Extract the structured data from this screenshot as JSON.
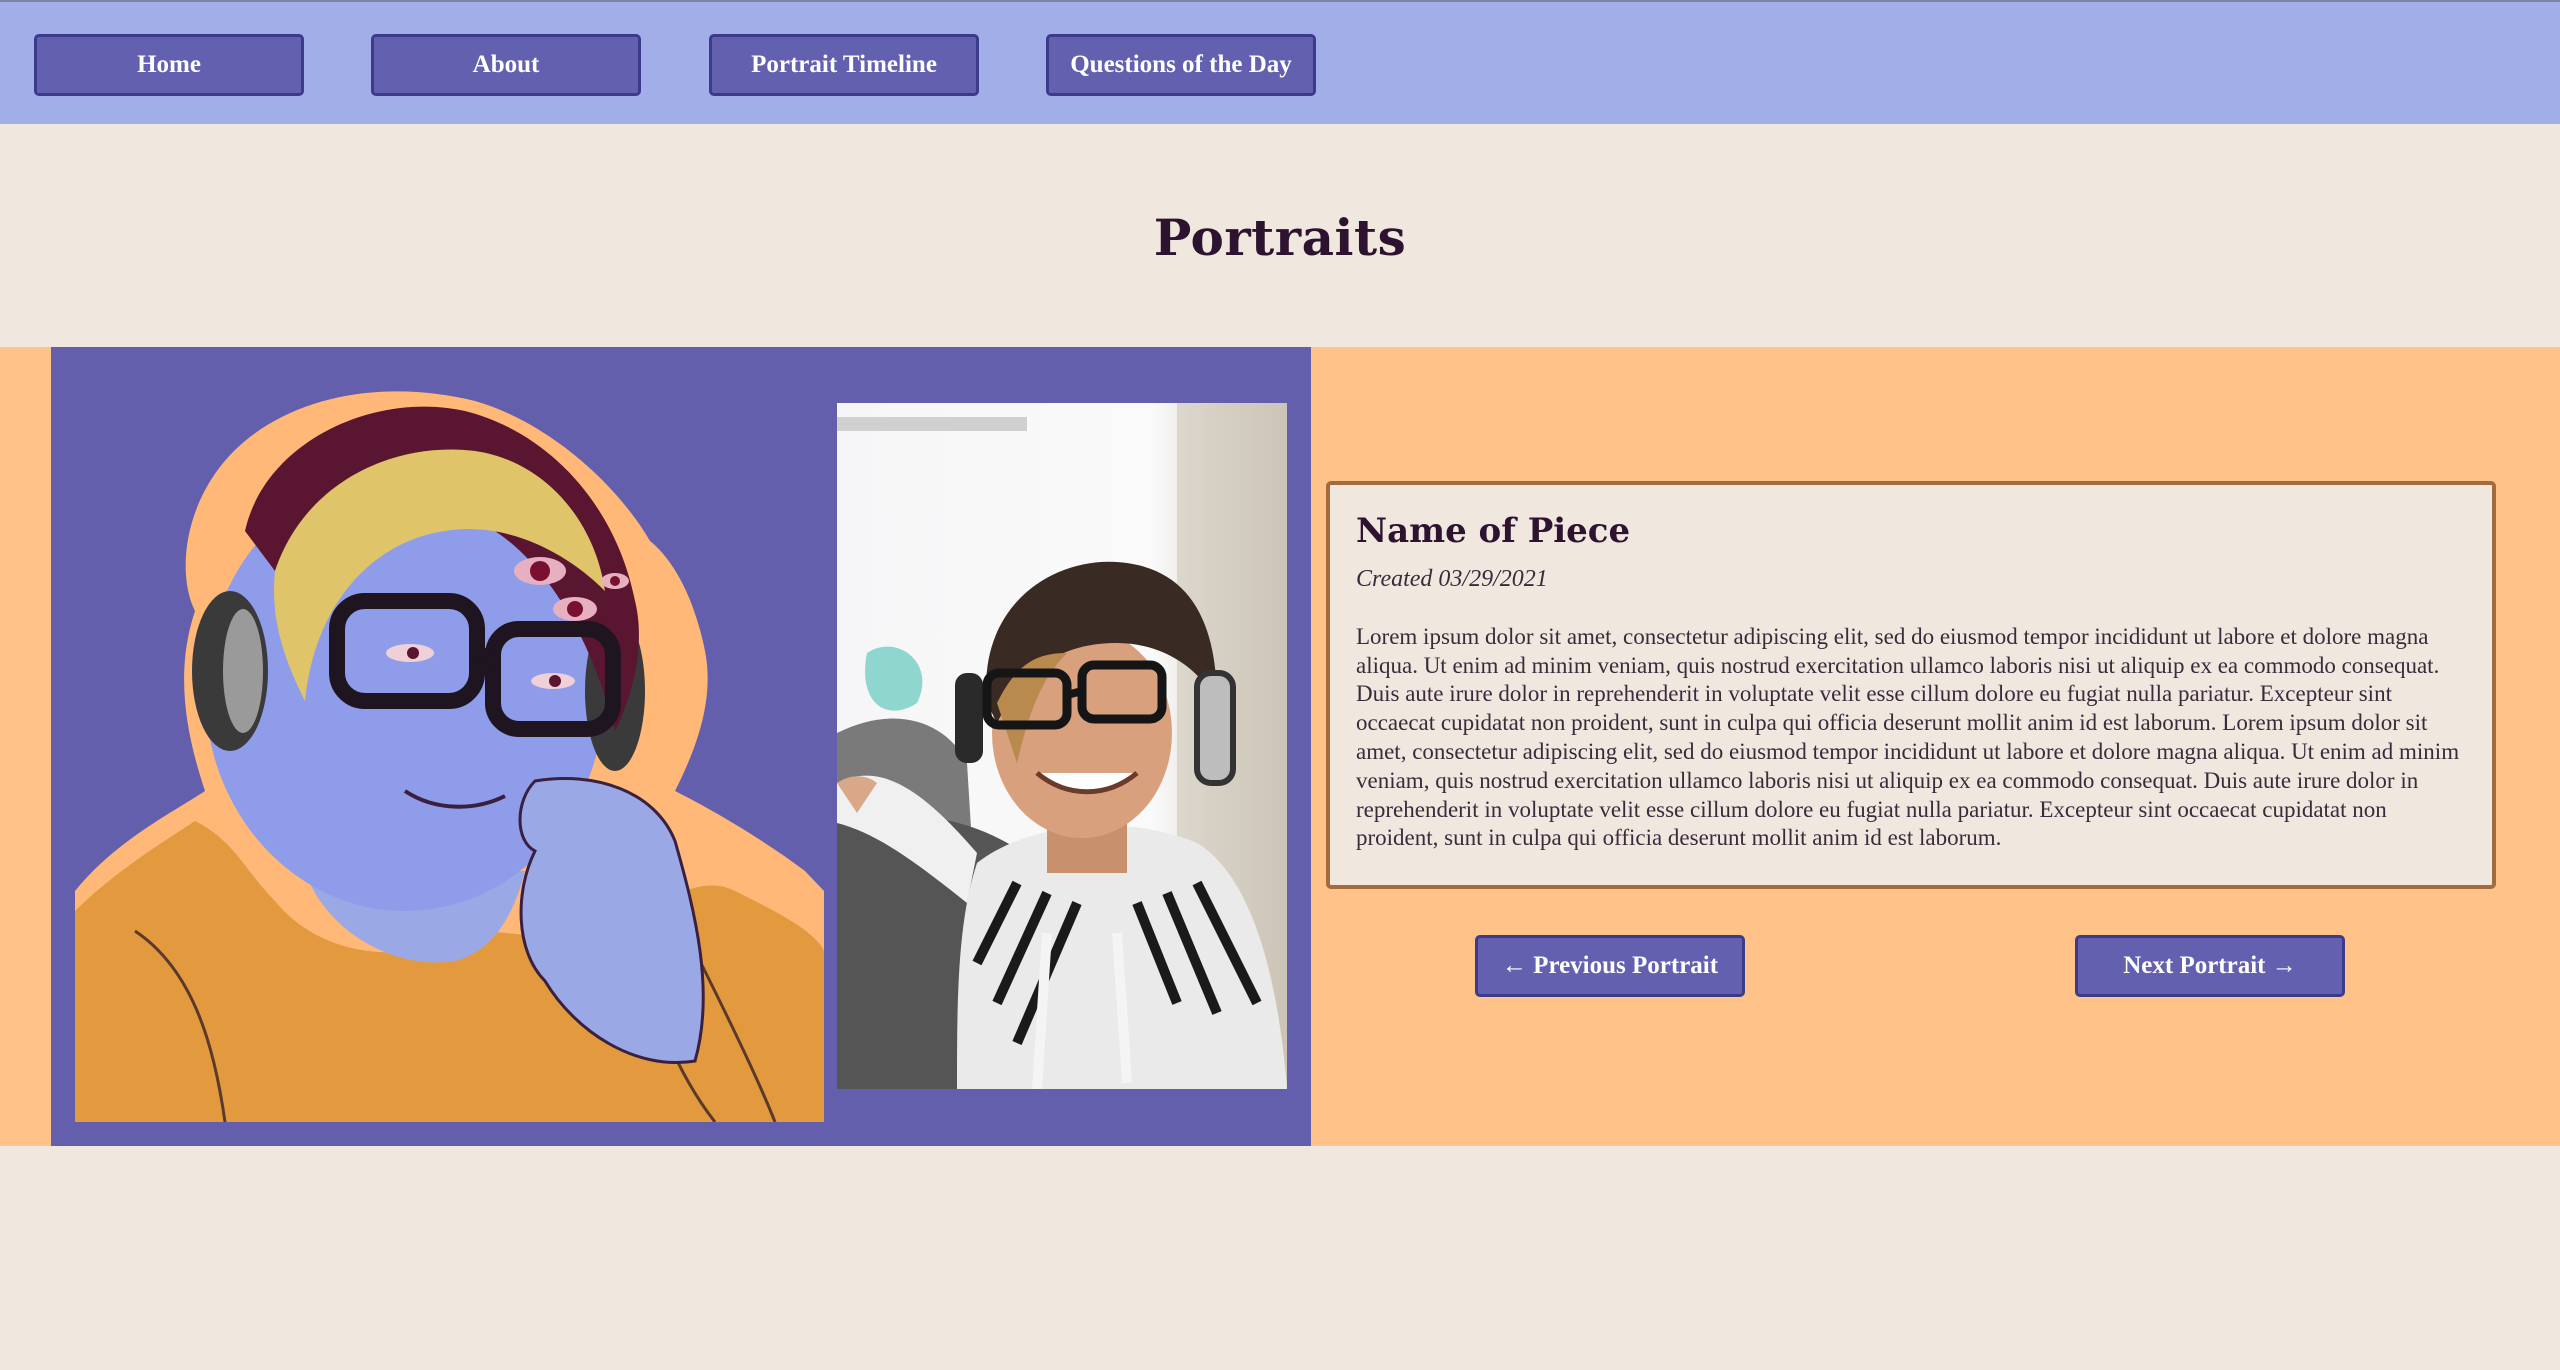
{
  "nav": {
    "items": [
      {
        "label": "Home"
      },
      {
        "label": "About"
      },
      {
        "label": "Portrait Timeline"
      },
      {
        "label": "Questions of the Day"
      }
    ]
  },
  "page": {
    "title": "Portraits"
  },
  "piece": {
    "name": "Name of Piece",
    "created": "Created 03/29/2021",
    "description": "Lorem ipsum dolor sit amet, consectetur adipiscing elit, sed do eiusmod tempor incididunt ut labore et dolore magna aliqua. Ut enim ad minim veniam, quis nostrud exercitation ullamco laboris nisi ut aliquip ex ea commodo consequat. Duis aute irure dolor in reprehenderit in voluptate velit esse cillum dolore eu fugiat nulla pariatur. Excepteur sint occaecat cupidatat non proident, sunt in culpa qui officia deserunt mollit anim id est laborum. Lorem ipsum dolor sit amet, consectetur adipiscing elit, sed do eiusmod tempor incididunt ut labore et dolore magna aliqua. Ut enim ad minim veniam, quis nostrud exercitation ullamco laboris nisi ut aliquip ex ea commodo consequat. Duis aute irure dolor in reprehenderit in voluptate velit esse cillum dolore eu fugiat nulla pariatur. Excepteur sint occaecat cupidatat non proident, sunt in culpa qui officia deserunt mollit anim id est laborum."
  },
  "pager": {
    "prev_label": "← Previous Portrait",
    "next_label": "Next Portrait →"
  },
  "colors": {
    "nav_bg": "#a2aee8",
    "button_bg": "#6360b0",
    "button_border": "#3c3a8a",
    "page_bg": "#f0e7df",
    "band_bg": "#ffc288",
    "image_panel_bg": "#635fad",
    "card_border": "#a46c3c",
    "heading_text": "#2d1330"
  }
}
